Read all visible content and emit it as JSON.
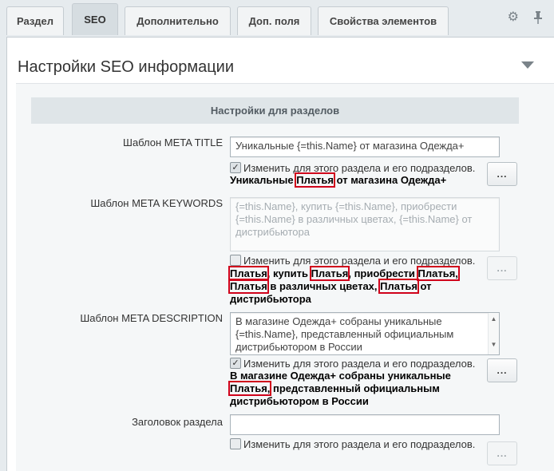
{
  "tabs": [
    {
      "label": "Раздел",
      "active": false
    },
    {
      "label": "SEO",
      "active": true
    },
    {
      "label": "Дополнительно",
      "active": false
    },
    {
      "label": "Доп. поля",
      "active": false
    },
    {
      "label": "Свойства элементов",
      "active": false
    }
  ],
  "tab_icons": {
    "settings": "gear-icon",
    "pin": "pin-icon"
  },
  "section": {
    "title": "Настройки SEO информации",
    "subheading": "Настройки для разделов"
  },
  "checkbox_label": "Изменить для этого раздела и его подразделов.",
  "button_label": "...",
  "rows": {
    "meta_title": {
      "label": "Шаблон META TITLE",
      "value": "Уникальные {=this.Name} от магазина Одежда+",
      "checked": true,
      "preview": [
        "Уникальные ",
        "Платья",
        " от магазина Одежда+"
      ]
    },
    "meta_keywords": {
      "label": "Шаблон META KEYWORDS",
      "value": "{=this.Name}, купить {=this.Name}, приобрести {=this.Name} в различных цветах, {=this.Name} от дистрибьютора",
      "checked": false,
      "preview": [
        "Платья",
        ", купить ",
        "Платья",
        ", приобрести ",
        "Платья,",
        "Платья",
        " в различных цветах, ",
        "Платья",
        " от дистрибьютора"
      ]
    },
    "meta_description": {
      "label": "Шаблон META DESCRIPTION",
      "value": "В магазине Одежда+ собраны уникальные {=this.Name}, представленный официальным дистрибьютором в России",
      "checked": true,
      "preview": [
        "В магазине Одежда+ собраны уникальные",
        "Платья,",
        " представленный официальным дистрибьютором в России"
      ]
    },
    "section_heading": {
      "label": "Заголовок раздела",
      "value": "",
      "checked": false
    }
  },
  "colors": {
    "highlight": "#d0021b",
    "active_tab": "#d6dde1"
  }
}
